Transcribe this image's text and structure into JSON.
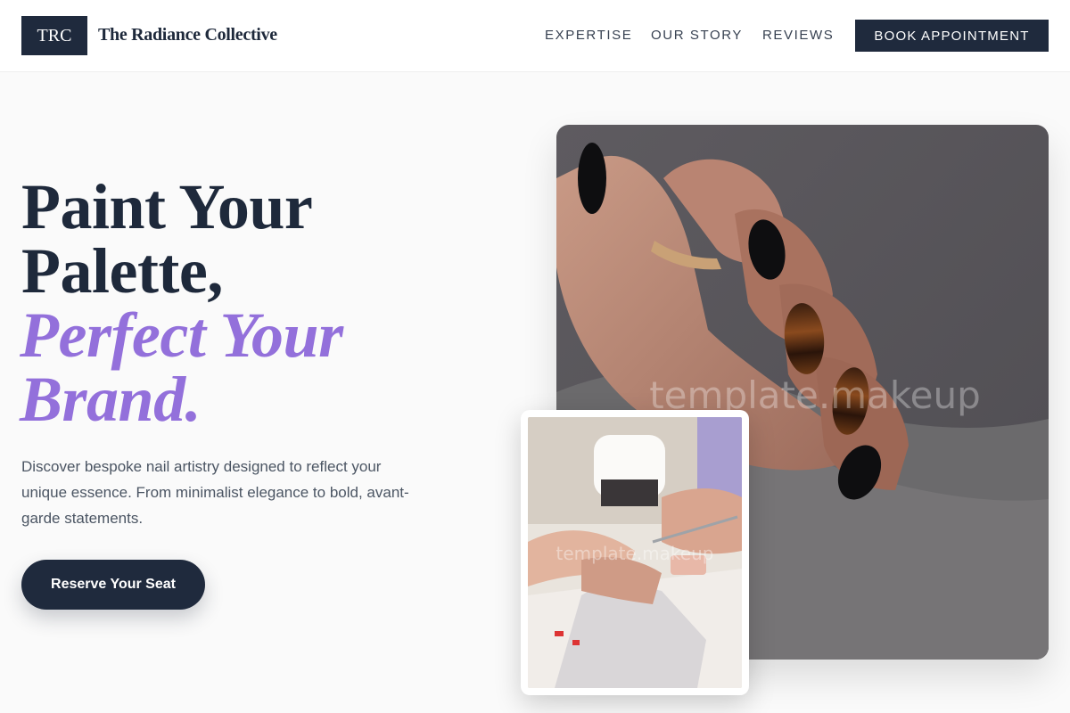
{
  "header": {
    "logo_mark": "TRC",
    "brand_name": "The Radiance Collective",
    "nav": [
      "EXPERTISE",
      "OUR STORY",
      "REVIEWS"
    ],
    "cta_label": "BOOK APPOINTMENT"
  },
  "hero": {
    "title_line1": "Paint Your",
    "title_line2": "Palette,",
    "accent_line1": "Perfect Your",
    "accent_line2": "Brand.",
    "description": "Discover bespoke nail artistry designed to reflect your unique essence. From minimalist elegance to bold, avant-garde statements.",
    "cta_label": "Reserve Your Seat"
  },
  "images": {
    "main_watermark": "template.makeup",
    "inset_watermark": "template.makeup"
  },
  "colors": {
    "primary": "#1f2a3d",
    "accent": "#9370db",
    "background": "#fafafa"
  }
}
